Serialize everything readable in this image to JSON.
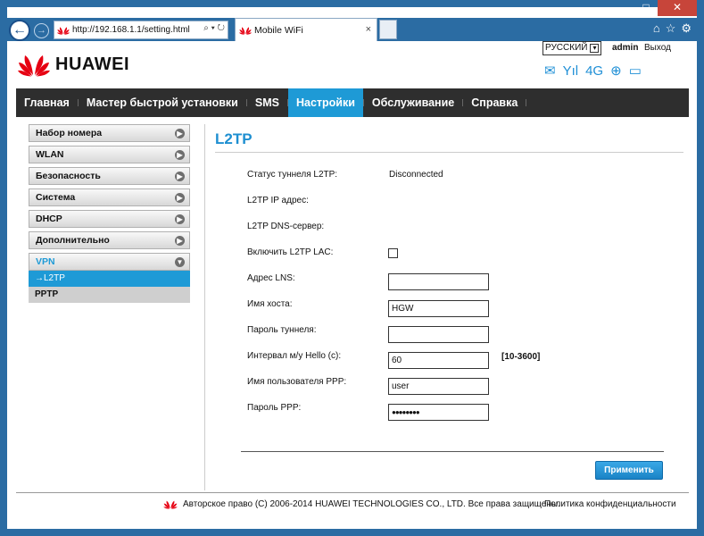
{
  "browser": {
    "url": "http://192.168.1.1/setting.html",
    "address_icons": "⌕ ▾ ↻",
    "tab_title": "Mobile WiFi",
    "tab_close": "×",
    "window_minimize": "–",
    "window_close": "✕",
    "back": "←",
    "forward": "→",
    "home": "⌂",
    "favorites": "☆",
    "settings": "⚙"
  },
  "header": {
    "logo_text": "HUAWEI",
    "brand_color": "#e60012",
    "language": "РУССКИЙ",
    "language_arrow": "▾",
    "user": "admin",
    "logout": "Выход",
    "network_type": "4G",
    "icons": [
      "mail-icon",
      "signal-icon",
      "globe-icon",
      "computer-icon"
    ],
    "mail_glyph": "✉",
    "signal_glyph": "Yıl",
    "globe_glyph": "⊕",
    "computer_glyph": "▭"
  },
  "nav": {
    "items": [
      "Главная",
      "Мастер быстрой установки",
      "SMS",
      "Настройки",
      "Обслуживание",
      "Справка"
    ],
    "active_index": 3,
    "active_color": "#1e9ad6"
  },
  "sidebar": {
    "items": [
      "Набор номера",
      "WLAN",
      "Безопасность",
      "Система",
      "DHCP",
      "Дополнительно"
    ],
    "expanded": "VPN",
    "chevron": "▶",
    "chevron_open": "▼",
    "sub_items": [
      "→L2TP",
      "PPTP"
    ]
  },
  "content": {
    "title": "L2TP",
    "tunnel_status_label": "Статус туннеля L2TP:",
    "tunnel_status_value": "Disconnected",
    "ip_label": "L2TP IP адрес:",
    "dns_label": "L2TP DNS-сервер:",
    "lac_label": "Включить L2TP LAC:",
    "lac_enabled": false,
    "lns_label": "Адрес LNS:",
    "lns_value": "",
    "hostname_label": "Имя хоста:",
    "hostname_value": "HGW",
    "tunnel_password_label": "Пароль туннеля:",
    "tunnel_password_value": "",
    "hello_label": "Интервал м/у Hello (с):",
    "hello_value": "60",
    "hello_range": "[10-3600]",
    "ppp_user_label": "Имя пользователя PPP:",
    "ppp_user_value": "user",
    "ppp_password_label": "Пароль PPP:",
    "ppp_password_value": "●●●●●●●●",
    "apply_label": "Применить"
  },
  "footer": {
    "copyright": "Авторское право (C) 2006-2014 HUAWEI TECHNOLOGIES CO., LTD. Все права защищены.",
    "privacy": "Политика конфиденциальности"
  }
}
